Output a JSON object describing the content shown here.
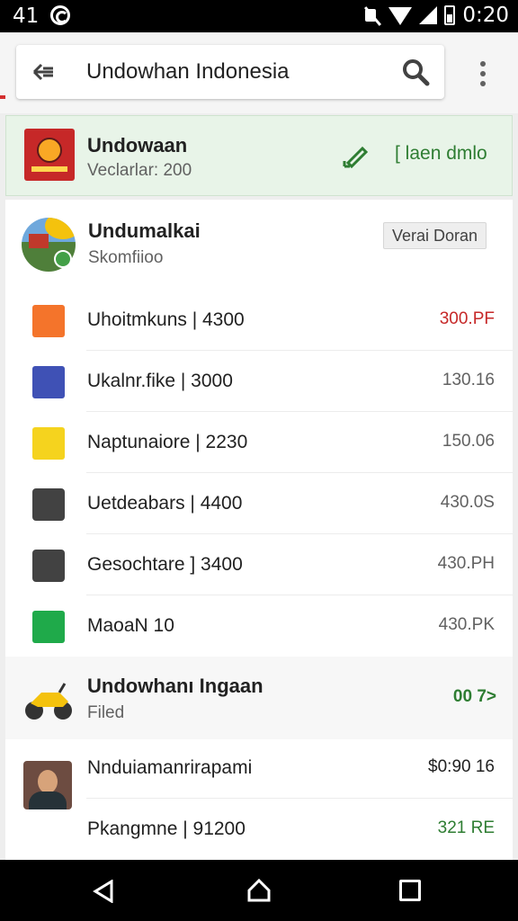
{
  "status_bar": {
    "left_time": "41",
    "clock": "0:20"
  },
  "search": {
    "query": "Undowhan Indonesia"
  },
  "featured": {
    "title": "Undowaan",
    "subtitle": "Veclarlar: 200",
    "link": "[ laen dmlo"
  },
  "header": {
    "title": "Undumalkai",
    "subtitle": "Skomfiioo",
    "button": "Verai Doran"
  },
  "rows": [
    {
      "label": "Uhoitmkuns | 4300",
      "value": "300.PF",
      "icon": "leaf-icon",
      "value_color": "#c62828"
    },
    {
      "label": "Ukalnr.fike |  3000",
      "value": "130.16",
      "icon": "person-pin-icon",
      "value_color": "#616161"
    },
    {
      "label": "Naptunaiore | 2230",
      "value": "150.06",
      "icon": "face-icon",
      "value_color": "#616161"
    },
    {
      "label": "Uetdeabars | 4400",
      "value": "430.0S",
      "icon": "document-icon",
      "value_color": "#616161"
    },
    {
      "label": "Gesochtare ] 3400",
      "value": "430.PH",
      "icon": "document-icon",
      "value_color": "#616161"
    },
    {
      "label": "MaoaN 10",
      "value": "430.PK",
      "icon": "play-icon",
      "value_color": "#616161"
    }
  ],
  "section": {
    "title": "Undowhanı Ingaan",
    "subtitle": "Filed",
    "value": "00 7>"
  },
  "bottom": [
    {
      "label": "Nnduiamanrirapami",
      "value": "$0:90 16",
      "value_color": "#212121"
    },
    {
      "label": "Pkangmne | 91200",
      "value": "321 RE",
      "value_color": "#2e7d32"
    }
  ],
  "colors": {
    "accent": "#2e7d32",
    "featured_bg": "#e8f4e8",
    "error": "#c62828"
  }
}
